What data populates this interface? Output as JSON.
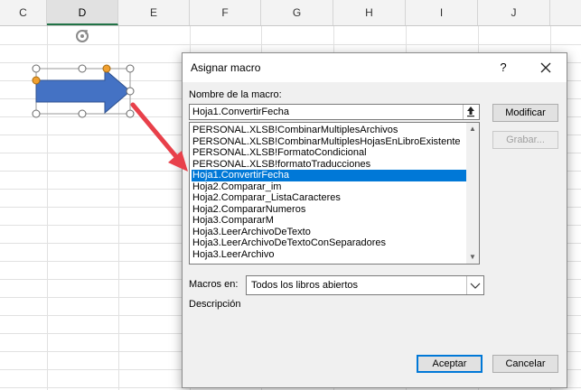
{
  "sheet": {
    "columns": [
      "C",
      "D",
      "E",
      "F",
      "G",
      "H",
      "I",
      "J"
    ],
    "selected_column": "D"
  },
  "dialog": {
    "title": "Asignar macro",
    "help_label": "?",
    "name_label": "Nombre de la macro:",
    "name_value": "Hoja1.ConvertirFecha",
    "macros": [
      "PERSONAL.XLSB!CombinarMultiplesArchivos",
      "PERSONAL.XLSB!CombinarMultiplesHojasEnLibroExistente",
      "PERSONAL.XLSB!FormatoCondicional",
      "PERSONAL.XLSB!formatoTraducciones",
      "Hoja1.ConvertirFecha",
      "Hoja2.Comparar_im",
      "Hoja2.Comparar_ListaCaracteres",
      "Hoja2.CompararNumeros",
      "Hoja3.CompararM",
      "Hoja3.LeerArchivoDeTexto",
      "Hoja3.LeerArchivoDeTextoConSeparadores",
      "Hoja3.LeerArchivo"
    ],
    "selected_index": 4,
    "modify_label": "Modificar",
    "record_label": "Grabar...",
    "macros_in_label": "Macros en:",
    "macros_in_value": "Todos los libros abiertos",
    "description_label": "Descripción",
    "accept_label": "Aceptar",
    "cancel_label": "Cancelar"
  },
  "colors": {
    "selection": "#0078d7",
    "shape_fill": "#4472c4",
    "arrow": "#e8404a"
  }
}
